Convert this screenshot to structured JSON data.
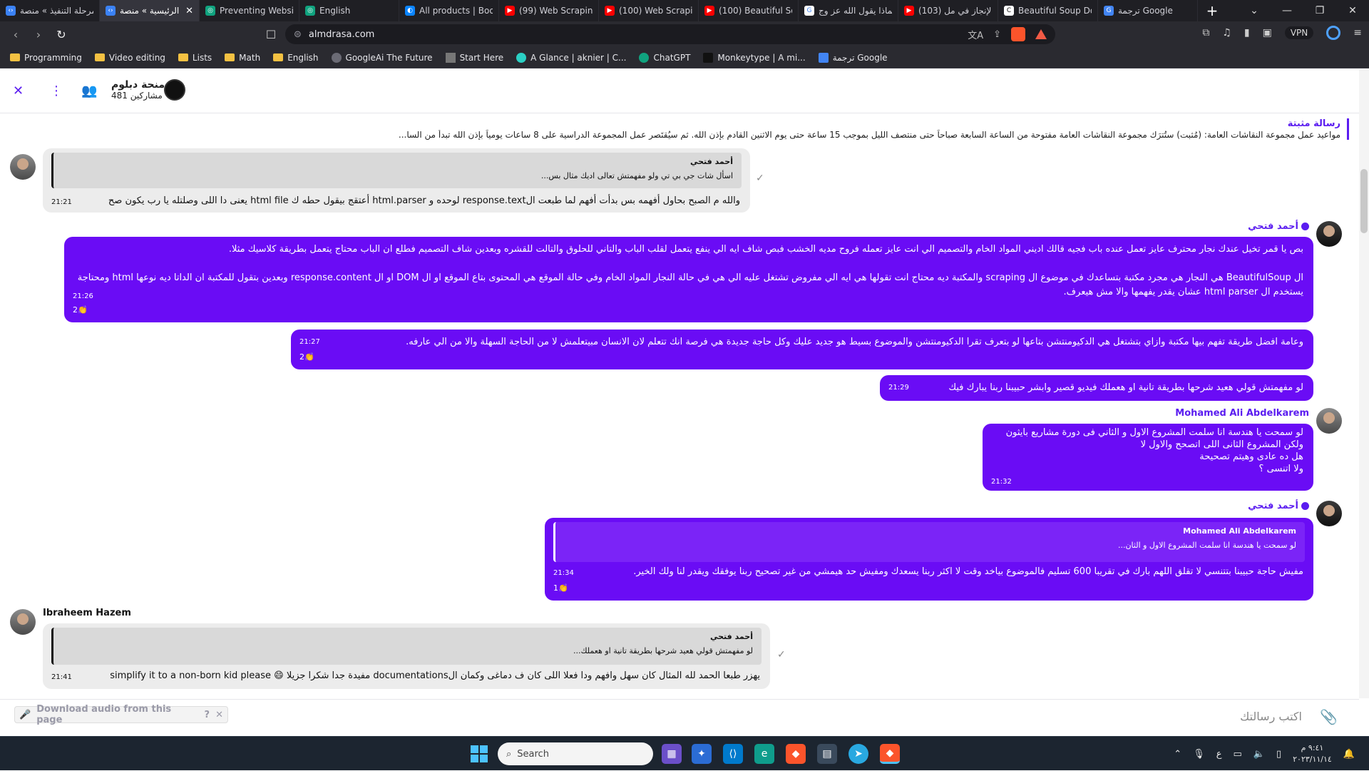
{
  "browser": {
    "tabs": [
      {
        "title": "مرحلة التنفيذ » منصة",
        "favicon": "code-icon",
        "color": "#3b82f6"
      },
      {
        "title": "الرئيسية » منصة",
        "favicon": "code-icon",
        "color": "#3b82f6",
        "active": true
      },
      {
        "title": "Preventing Website",
        "favicon": "chatgpt-icon",
        "color": "#10a37f"
      },
      {
        "title": "English",
        "favicon": "chatgpt-icon",
        "color": "#10a37f"
      },
      {
        "title": "All products | Book",
        "favicon": "bookstore-icon",
        "color": "#0a84ff"
      },
      {
        "title": "(99) Web Scraping",
        "favicon": "youtube-icon",
        "color": "#ff0000"
      },
      {
        "title": "(100) Web Scraping",
        "favicon": "youtube-icon",
        "color": "#ff0000"
      },
      {
        "title": "(100) Beautiful Sou",
        "favicon": "youtube-icon",
        "color": "#ff0000"
      },
      {
        "title": "لماذا يقول الله عز وج",
        "favicon": "google-icon",
        "color": "#ffffff"
      },
      {
        "title": "(103) الإنجاز في مل",
        "favicon": "youtube-icon",
        "color": "#ff0000"
      },
      {
        "title": "Beautiful Soup Doc",
        "favicon": "doc-icon",
        "color": "#ffffff"
      },
      {
        "title": "ترجمة Google",
        "favicon": "translate-icon",
        "color": "#4285f4"
      }
    ],
    "url": "almdrasa.com",
    "vpn_label": "VPN",
    "bookmarks": [
      {
        "label": "Programming",
        "type": "folder"
      },
      {
        "label": "Video editing",
        "type": "folder"
      },
      {
        "label": "Lists",
        "type": "folder"
      },
      {
        "label": "Math",
        "type": "folder"
      },
      {
        "label": "English",
        "type": "folder"
      },
      {
        "label": "GoogleAi The Future",
        "type": "link"
      },
      {
        "label": "Start Here",
        "type": "link"
      },
      {
        "label": "A Glance | aknier | C...",
        "type": "link"
      },
      {
        "label": "ChatGPT",
        "type": "link"
      },
      {
        "label": "Monkeytype | A mi...",
        "type": "link"
      },
      {
        "label": "ترجمة Google",
        "type": "link"
      }
    ]
  },
  "chat": {
    "group_name": "منحة دبلوم...",
    "participants": "481 مشاركين",
    "pinned_title": "رسالة مثبتة",
    "pinned_text": "مواعيد عمل مجموعة النقاشات العامة: (مُثبت) ستُترَك مجموعة النقاشات العامة مفتوحة من الساعة السابعة صباحاً حتى منتصف الليل بموجب 15 ساعة حتى يوم الاثنين القادم بإذن الله. ثم سيُقتَصر عمل المجموعة الدراسية على 8 ساعات يومياً بإذن الله تبدأ من السا...",
    "messages": [
      {
        "quote_name": "أحمد فتحي",
        "quote_text": "اسأل شات جي بي تي ولو مفهمتش تعالى اديك مثال بس...",
        "text": "والله م الصبح بحاول أفهمه بس بدأت أفهم لما طبعت الresponse.text لوحده و html.parser أعتقج بيقول حطه ك html file يعنى دا اللى وصلتله يا رب يكون صح",
        "time": "21:21"
      },
      {
        "sender": "أحمد فتحي",
        "text": "بص يا قمر تخيل عندك نجار محترف عايز تعمل عنده باب فجيه قالك اديني المواد الخام والتصميم الي انت عايز تعمله فروح مديه الخشب فبص شاف ايه الي ينفع يتعمل لقلب الباب والتاني للحلوق والتالت للقشره وبعدين شاف التصميم فطلع ان الباب محتاج يتعمل بطريقة كلاسيك مثلا.\n\nال BeautifulSoup هي النجار هي مجرد مكتبة بتساعدك في موضوع ال scraping والمكتبة ديه محتاج انت تقولها هي ايه الي مفروض تشتغل عليه الي هي في حالة النجار المواد الخام وفي حالة الموقع هي المحتوى بتاع الموقع او ال DOM او ال response.content وبعدين بتقول للمكتبة ان الداتا ديه نوعها html ومحتاجة يستخدم ال html parser عشان يقدر يفهمها والا مش هيعرف.",
        "time": "21:26",
        "reaction": "2👏"
      },
      {
        "text": "وعامة افضل طريقة تفهم بيها مكتبة وازاي بتشتغل هي الدكيومنتشن بتاعها لو بتعرف تقرا الدكيومنتشن والموضوع بسيط هو جديد عليك وكل حاجة جديدة هي فرصة انك تتعلم لان الانسان مبيتعلمش لا من الحاجة السهلة والا من الي عارفه.",
        "time": "21:27",
        "reaction": "2👏"
      },
      {
        "text": "لو مفهمتش قولي هعيد شرحها بطريقة تانية او هعملك فيديو قصير وابشر حبيبنا ربنا يبارك فيك",
        "time": "21:29"
      },
      {
        "sender": "Mohamed Ali Abdelkarem",
        "text": "لو سمحت يا هندسة انا سلمت المشروع الاول و الثاني فى دورة مشاريع بايثون\nولكن المشروع الثانى اللى اتصحح والاول لا\nهل ده عادى وهيتم تصحيحة\nولا اتنسى ؟",
        "time": "21:32"
      },
      {
        "sender": "أحمد فتحي",
        "quote_name": "Mohamed Ali Abdelkarem",
        "quote_text": "لو سمحت يا هندسة انا سلمت المشروع الاول و الثان...",
        "text": "مفيش حاجة حبيبنا بتتنسي لا تقلق  اللهم بارك في تقريبا 600 تسليم فالموضوع بياخد وقت لا اكثر ربنا يسعدك ومفيش حد هيمشي من غير تصحيح ربنا يوفقك ويقدر لنا ولك الخير.",
        "time": "21:34",
        "reaction": "1👏"
      },
      {
        "sender": "Ibraheem Hazem",
        "quote_name": "أحمد فتحي",
        "quote_text": "لو مفهمتش قولي هعيد شرحها بطريقة تانية او هعملك...",
        "text": "يهزر طبعا الحمد لله المثال كان سهل وافهم ودا فعلا اللى كان ف دماغى وكمان الdocumentations مفيدة جدا شكرا جزيلا 😄 simplify it to a non-born kid please",
        "time": "21:41"
      }
    ],
    "composer_placeholder": "اكتب رسالتك",
    "download_audio": "Download audio from this page"
  },
  "taskbar": {
    "search_label": "Search",
    "time": "٩:٤١ م",
    "date": "٢٠٢٣/١١/١٤",
    "lang": "ع"
  }
}
